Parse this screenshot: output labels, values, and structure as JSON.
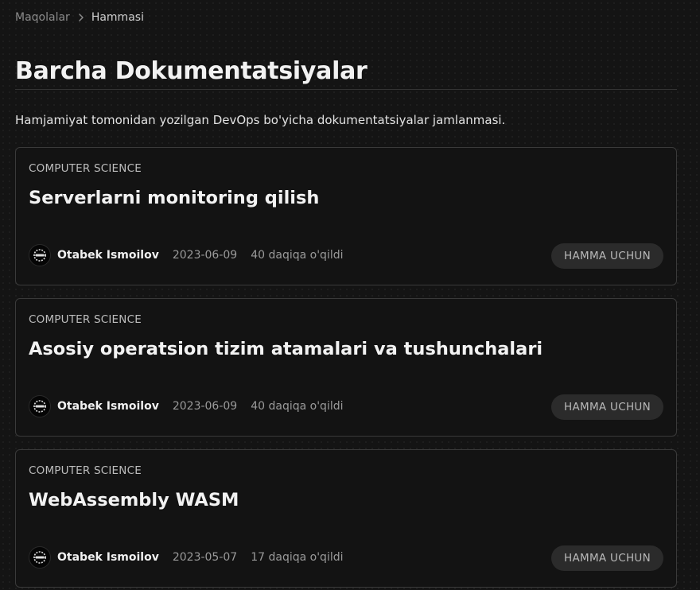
{
  "breadcrumb": {
    "items": [
      "Maqolalar",
      "Hammasi"
    ],
    "separator_icon": "chevron-right-icon"
  },
  "header": {
    "title": "Barcha Dokumentatsiyalar",
    "description": "Hamjamiyat tomonidan yozilgan DevOps bo'yicha dokumentatsiyalar jamlanmasi."
  },
  "articles": [
    {
      "category": "COMPUTER SCIENCE",
      "title": "Serverlarni monitoring qilish",
      "author": "Otabek Ismoilov",
      "date": "2023-06-09",
      "read_time": "40 daqiqa o'qildi",
      "access": "HAMMA UCHUN"
    },
    {
      "category": "COMPUTER SCIENCE",
      "title": "Asosiy operatsion tizim atamalari va tushunchalari",
      "author": "Otabek Ismoilov",
      "date": "2023-06-09",
      "read_time": "40 daqiqa o'qildi",
      "access": "HAMMA UCHUN"
    },
    {
      "category": "COMPUTER SCIENCE",
      "title": "WebAssembly WASM",
      "author": "Otabek Ismoilov",
      "date": "2023-05-07",
      "read_time": "17 daqiqa o'qildi",
      "access": "HAMMA UCHUN"
    }
  ],
  "colors": {
    "background": "#141414",
    "card_border": "#3a3a3a",
    "badge_bg": "#2b2b2b",
    "text_primary": "#f2f2f2",
    "text_muted": "#9a9a9a"
  }
}
